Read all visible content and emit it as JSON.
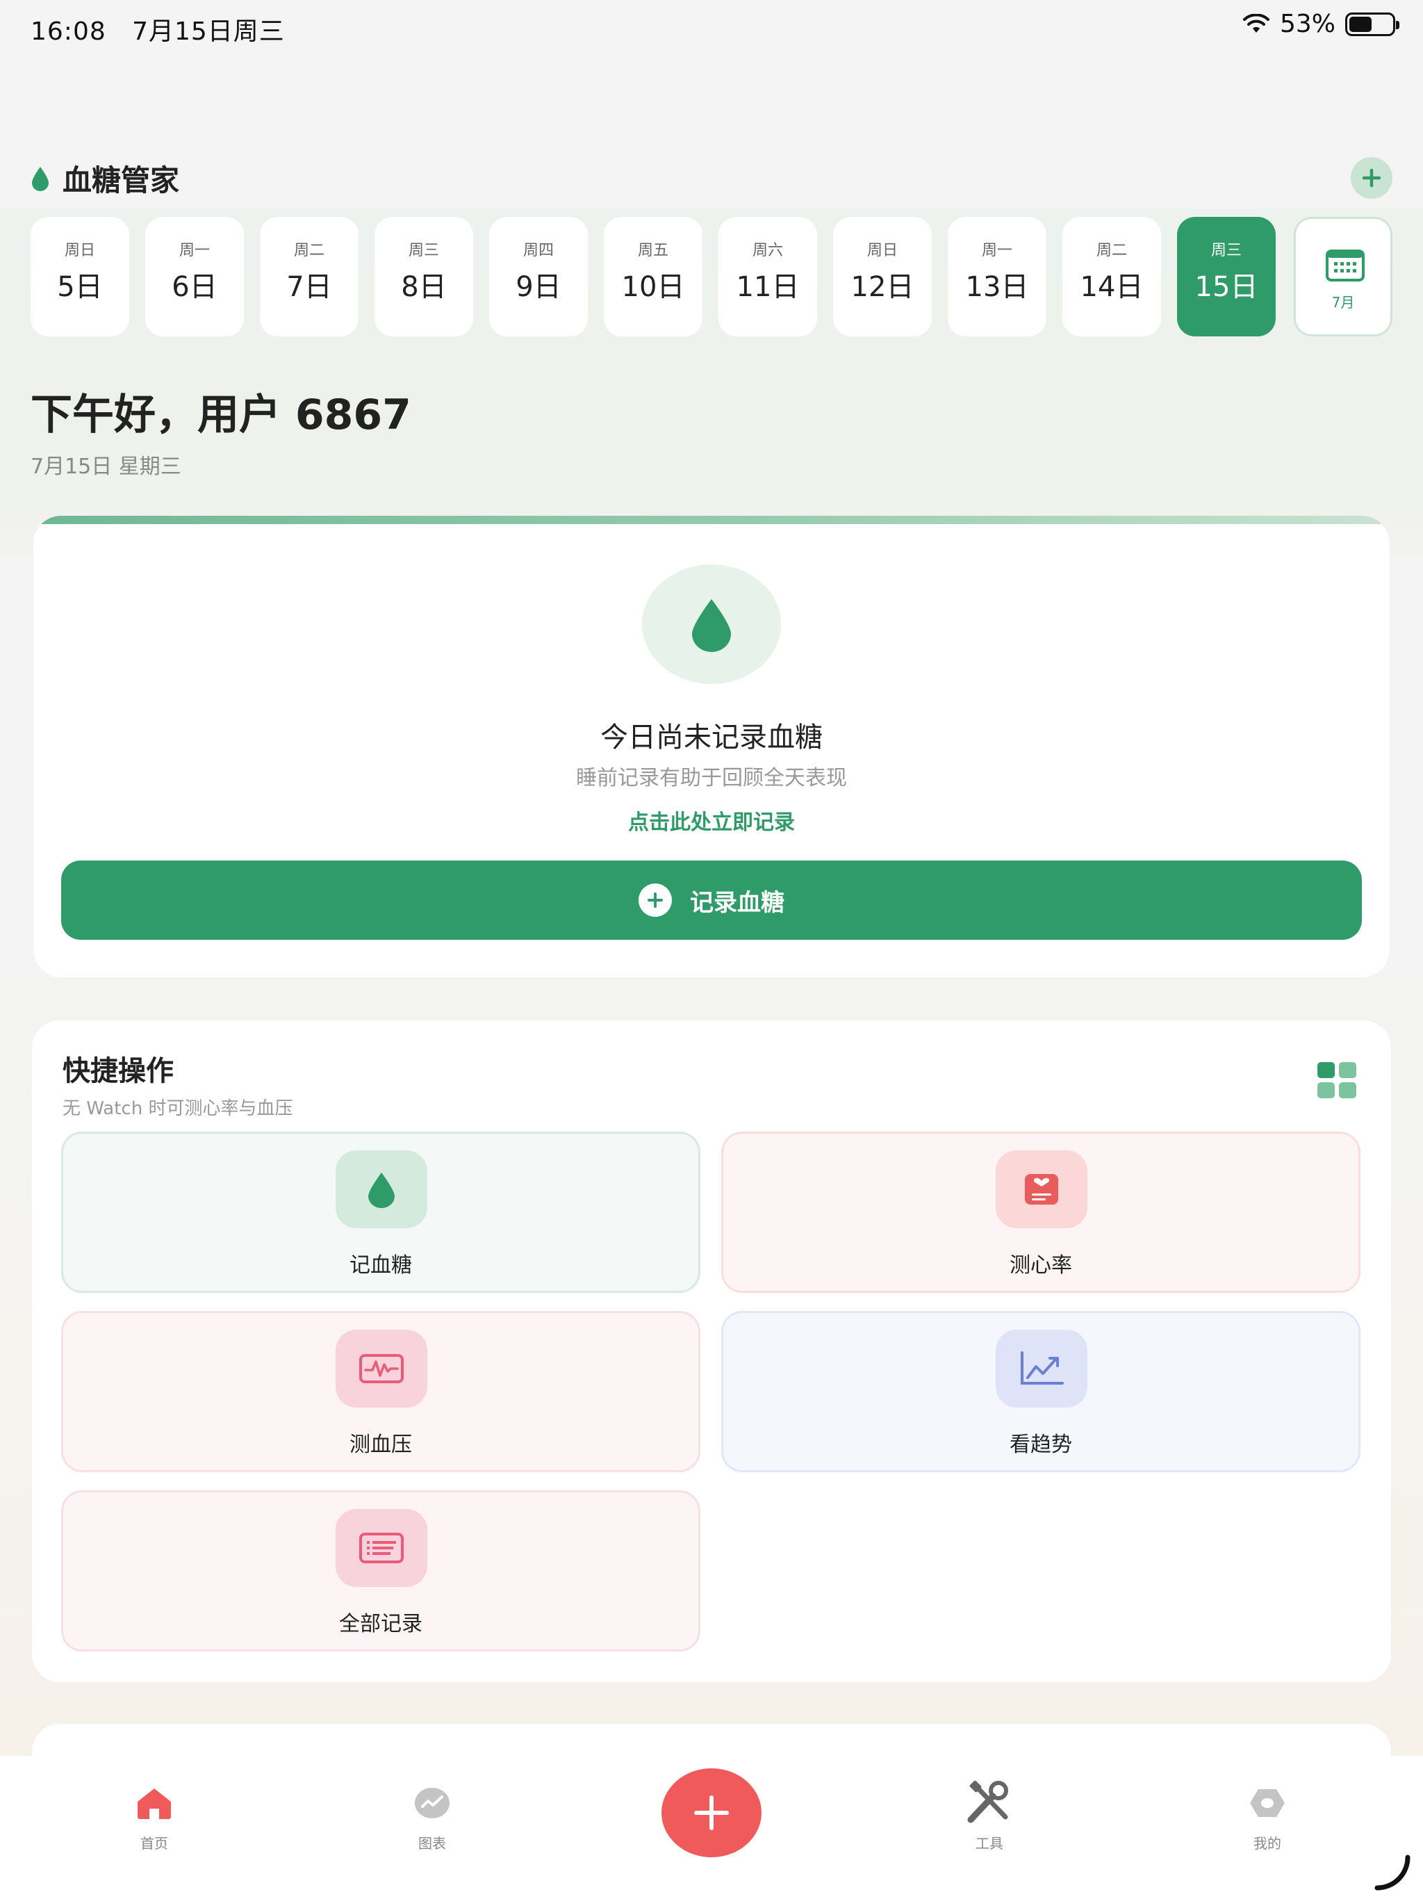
{
  "status_bar": {
    "time": "16:08",
    "date": "7月15日周三",
    "battery": "53%",
    "battery_level": 0.53
  },
  "header": {
    "title": "血糖管家",
    "icon": "water-drop-icon",
    "add_icon": "plus-icon"
  },
  "date_strip": {
    "days": [
      {
        "weekday": "周日",
        "day": "5日"
      },
      {
        "weekday": "周一",
        "day": "6日"
      },
      {
        "weekday": "周二",
        "day": "7日"
      },
      {
        "weekday": "周三",
        "day": "8日"
      },
      {
        "weekday": "周四",
        "day": "9日"
      },
      {
        "weekday": "周五",
        "day": "10日"
      },
      {
        "weekday": "周六",
        "day": "11日"
      },
      {
        "weekday": "周日",
        "day": "12日"
      },
      {
        "weekday": "周一",
        "day": "13日"
      },
      {
        "weekday": "周二",
        "day": "14日"
      },
      {
        "weekday": "周三",
        "day": "15日",
        "selected": true
      }
    ],
    "calendar_month": "7月"
  },
  "greeting": {
    "text": "下午好，用户 6867",
    "date": "7月15日 星期三"
  },
  "glucose_card": {
    "title": "今日尚未记录血糖",
    "subtitle": "睡前记录有助于回顾全天表现",
    "link": "点击此处立即记录",
    "button": "记录血糖"
  },
  "quick_actions": {
    "title": "快捷操作",
    "subtitle": "无 Watch 时可测心率与血压",
    "items": [
      {
        "label": "记血糖",
        "icon": "water-drop-icon"
      },
      {
        "label": "测心率",
        "icon": "heart-card-icon"
      },
      {
        "label": "测血压",
        "icon": "pulse-monitor-icon"
      },
      {
        "label": "看趋势",
        "icon": "trend-chart-icon"
      },
      {
        "label": "全部记录",
        "icon": "list-document-icon"
      }
    ]
  },
  "tabbar": {
    "items": [
      {
        "label": "首页",
        "icon": "home-icon",
        "active": true
      },
      {
        "label": "图表",
        "icon": "chart-icon"
      },
      {
        "label": "",
        "icon": "plus-icon"
      },
      {
        "label": "工具",
        "icon": "tools-icon"
      },
      {
        "label": "我的",
        "icon": "profile-icon"
      }
    ]
  },
  "colors": {
    "primary": "#2e9b69",
    "accent_red": "#f05a5a",
    "background": "#f4f4f4"
  }
}
